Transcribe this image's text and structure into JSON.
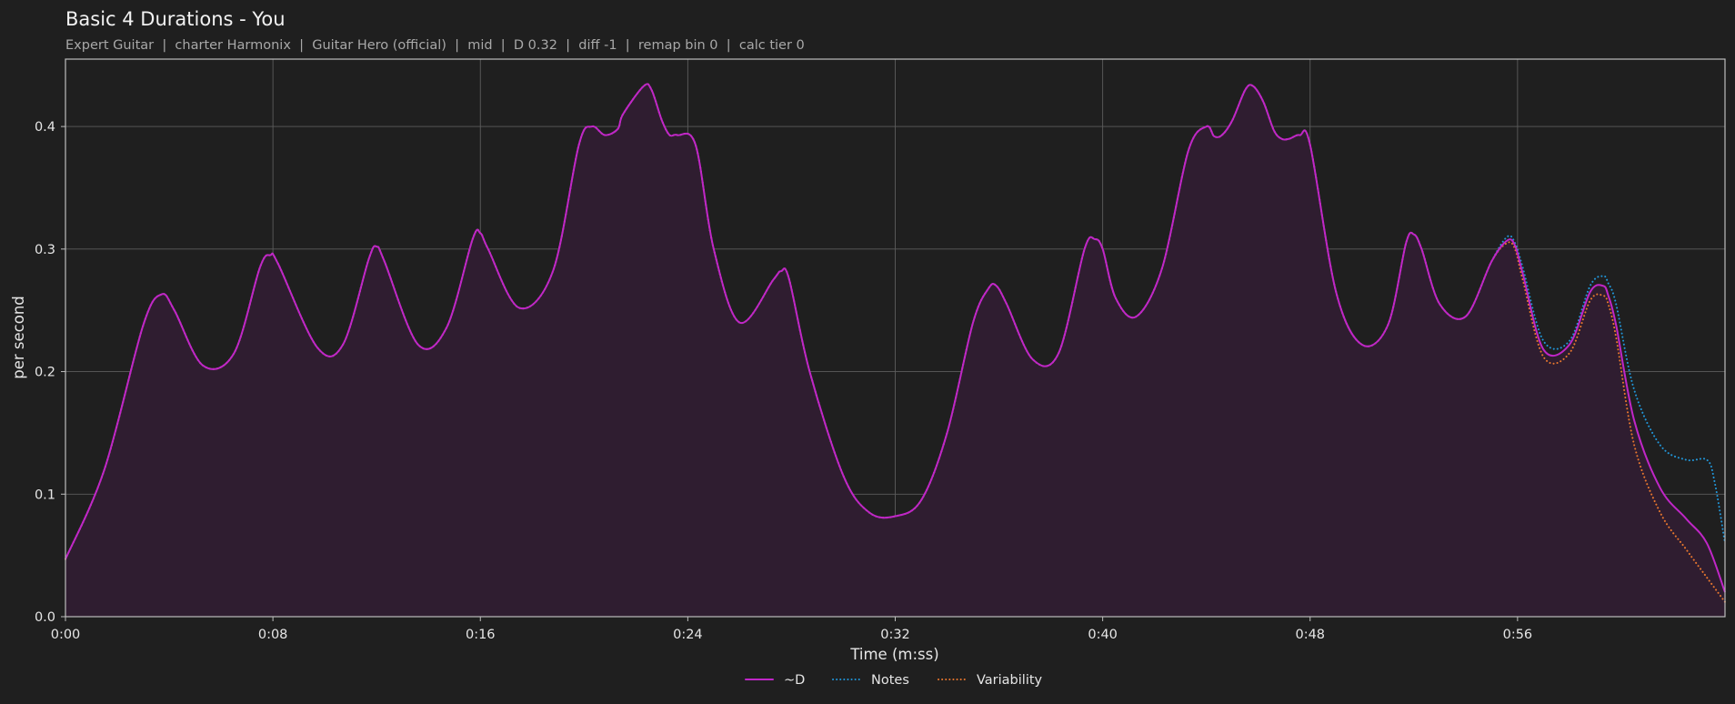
{
  "chart_data": {
    "type": "line",
    "title": "Basic 4 Durations - You",
    "subtitle": "Expert Guitar  |  charter Harmonix  |  Guitar Hero (official)  |  mid  |  D 0.32  |  diff -1  |  remap bin 0  |  calc tier 0",
    "xlabel": "Time (m:ss)",
    "ylabel": "per second",
    "xlim": [
      0,
      64
    ],
    "ylim": [
      0,
      0.455
    ],
    "x_ticks": [
      0,
      8,
      16,
      24,
      32,
      40,
      48,
      56
    ],
    "x_tick_labels": [
      "0:00",
      "0:08",
      "0:16",
      "0:24",
      "0:32",
      "0:40",
      "0:48",
      "0:56"
    ],
    "y_ticks": [
      0,
      0.1,
      0.2,
      0.3,
      0.4
    ],
    "y_tick_labels": [
      "0.0",
      "0.1",
      "0.2",
      "0.3",
      "0.4"
    ],
    "grid": true,
    "legend": "bottom-center",
    "series": [
      {
        "name": "~D",
        "color": "#c026c7",
        "style": "solid",
        "fill": "#2f1d30",
        "x": [
          0,
          1.5,
          3,
          3.7,
          4.2,
          5.3,
          6.5,
          7.5,
          7.9,
          8.2,
          9.7,
          10.7,
          11.7,
          12.0,
          12.3,
          13.6,
          14.7,
          15.7,
          16.0,
          16.3,
          17.5,
          18.8,
          19.8,
          20.3,
          20.8,
          21.3,
          21.5,
          22.3,
          22.6,
          23.0,
          23.3,
          23.6,
          24.3,
          25.0,
          26.0,
          27.3,
          27.6,
          27.9,
          28.7,
          30.0,
          31.0,
          32.0,
          33.0,
          34.0,
          35.0,
          35.6,
          35.9,
          36.3,
          37.3,
          38.3,
          39.3,
          39.7,
          40.0,
          40.5,
          41.3,
          42.3,
          43.3,
          44.0,
          44.3,
          44.6,
          45.0,
          45.5,
          45.8,
          46.2,
          46.6,
          46.9,
          47.2,
          47.6,
          48.0,
          49.0,
          50.0,
          51.0,
          51.7,
          52.0,
          52.3,
          53.0,
          54.0,
          55.0,
          55.6,
          55.9,
          56.2,
          57.0,
          58.0,
          58.8,
          59.3,
          59.5,
          59.8,
          60.5,
          61.5,
          62.5,
          63.3,
          64.0
        ],
        "values": [
          0.047,
          0.12,
          0.238,
          0.263,
          0.25,
          0.205,
          0.215,
          0.285,
          0.295,
          0.288,
          0.22,
          0.222,
          0.292,
          0.302,
          0.29,
          0.222,
          0.236,
          0.308,
          0.313,
          0.3,
          0.252,
          0.282,
          0.385,
          0.4,
          0.393,
          0.398,
          0.41,
          0.433,
          0.43,
          0.405,
          0.393,
          0.393,
          0.385,
          0.3,
          0.24,
          0.275,
          0.282,
          0.276,
          0.2,
          0.115,
          0.085,
          0.082,
          0.095,
          0.15,
          0.24,
          0.268,
          0.27,
          0.255,
          0.21,
          0.215,
          0.3,
          0.308,
          0.3,
          0.26,
          0.245,
          0.285,
          0.38,
          0.4,
          0.392,
          0.393,
          0.405,
          0.43,
          0.433,
          0.42,
          0.397,
          0.39,
          0.39,
          0.393,
          0.385,
          0.265,
          0.222,
          0.238,
          0.305,
          0.312,
          0.3,
          0.255,
          0.245,
          0.29,
          0.307,
          0.303,
          0.28,
          0.218,
          0.222,
          0.265,
          0.27,
          0.262,
          0.238,
          0.16,
          0.105,
          0.08,
          0.06,
          0.02
        ]
      },
      {
        "name": "Notes",
        "color": "#2196d9",
        "style": "dotted",
        "x": [
          0,
          1.5,
          3,
          3.7,
          4.2,
          5.3,
          6.5,
          7.5,
          7.9,
          8.2,
          9.7,
          10.7,
          11.7,
          12.0,
          12.3,
          13.6,
          14.7,
          15.7,
          16.0,
          16.3,
          17.5,
          18.8,
          19.8,
          20.3,
          20.8,
          21.3,
          21.5,
          22.3,
          22.6,
          23.0,
          23.3,
          23.6,
          24.3,
          25.0,
          26.0,
          27.3,
          27.6,
          27.9,
          28.7,
          30.0,
          31.0,
          32.0,
          33.0,
          34.0,
          35.0,
          35.6,
          35.9,
          36.3,
          37.3,
          38.3,
          39.3,
          39.7,
          40.0,
          40.5,
          41.3,
          42.3,
          43.3,
          44.0,
          44.3,
          44.6,
          45.0,
          45.5,
          45.8,
          46.2,
          46.6,
          46.9,
          47.2,
          47.6,
          48.0,
          49.0,
          50.0,
          51.0,
          51.7,
          52.0,
          52.3,
          53.0,
          54.0,
          55.0,
          55.6,
          55.9,
          56.2,
          57.0,
          58.0,
          58.8,
          59.3,
          59.5,
          59.8,
          60.5,
          61.5,
          62.5,
          63.3,
          63.6,
          64.0
        ],
        "values": [
          0.047,
          0.12,
          0.238,
          0.263,
          0.25,
          0.205,
          0.215,
          0.285,
          0.295,
          0.288,
          0.22,
          0.222,
          0.292,
          0.302,
          0.29,
          0.222,
          0.236,
          0.308,
          0.313,
          0.3,
          0.252,
          0.282,
          0.385,
          0.4,
          0.393,
          0.398,
          0.41,
          0.433,
          0.43,
          0.405,
          0.393,
          0.393,
          0.385,
          0.3,
          0.24,
          0.275,
          0.282,
          0.276,
          0.2,
          0.115,
          0.085,
          0.082,
          0.095,
          0.15,
          0.24,
          0.268,
          0.27,
          0.255,
          0.21,
          0.215,
          0.3,
          0.308,
          0.3,
          0.26,
          0.245,
          0.285,
          0.38,
          0.4,
          0.392,
          0.393,
          0.405,
          0.43,
          0.433,
          0.42,
          0.397,
          0.39,
          0.39,
          0.393,
          0.385,
          0.265,
          0.222,
          0.238,
          0.305,
          0.312,
          0.3,
          0.255,
          0.245,
          0.29,
          0.31,
          0.305,
          0.285,
          0.225,
          0.225,
          0.27,
          0.278,
          0.272,
          0.255,
          0.185,
          0.14,
          0.128,
          0.128,
          0.11,
          0.06
        ]
      },
      {
        "name": "Variability",
        "color": "#e8772e",
        "style": "dotted",
        "x": [
          0,
          1.5,
          3,
          3.7,
          4.2,
          5.3,
          6.5,
          7.5,
          7.9,
          8.2,
          9.7,
          10.7,
          11.7,
          12.0,
          12.3,
          13.6,
          14.7,
          15.7,
          16.0,
          16.3,
          17.5,
          18.8,
          19.8,
          20.3,
          20.8,
          21.3,
          21.5,
          22.3,
          22.6,
          23.0,
          23.3,
          23.6,
          24.3,
          25.0,
          26.0,
          27.3,
          27.6,
          27.9,
          28.7,
          30.0,
          31.0,
          32.0,
          33.0,
          34.0,
          35.0,
          35.6,
          35.9,
          36.3,
          37.3,
          38.3,
          39.3,
          39.7,
          40.0,
          40.5,
          41.3,
          42.3,
          43.3,
          44.0,
          44.3,
          44.6,
          45.0,
          45.5,
          45.8,
          46.2,
          46.6,
          46.9,
          47.2,
          47.6,
          48.0,
          49.0,
          50.0,
          51.0,
          51.7,
          52.0,
          52.3,
          53.0,
          54.0,
          55.0,
          55.6,
          55.9,
          56.2,
          57.0,
          58.0,
          58.8,
          59.3,
          59.5,
          59.8,
          60.5,
          61.5,
          62.5,
          63.3,
          64.0
        ],
        "values": [
          0.047,
          0.12,
          0.238,
          0.263,
          0.25,
          0.205,
          0.215,
          0.285,
          0.295,
          0.288,
          0.22,
          0.222,
          0.292,
          0.302,
          0.29,
          0.222,
          0.236,
          0.308,
          0.313,
          0.3,
          0.252,
          0.282,
          0.385,
          0.4,
          0.393,
          0.398,
          0.41,
          0.433,
          0.43,
          0.405,
          0.393,
          0.393,
          0.385,
          0.3,
          0.24,
          0.275,
          0.282,
          0.276,
          0.2,
          0.115,
          0.085,
          0.082,
          0.095,
          0.15,
          0.24,
          0.268,
          0.27,
          0.255,
          0.21,
          0.215,
          0.3,
          0.308,
          0.3,
          0.26,
          0.245,
          0.285,
          0.38,
          0.4,
          0.392,
          0.393,
          0.405,
          0.43,
          0.433,
          0.42,
          0.397,
          0.39,
          0.39,
          0.393,
          0.385,
          0.265,
          0.222,
          0.238,
          0.305,
          0.312,
          0.3,
          0.255,
          0.245,
          0.29,
          0.305,
          0.3,
          0.275,
          0.212,
          0.215,
          0.258,
          0.262,
          0.255,
          0.228,
          0.14,
          0.085,
          0.055,
          0.032,
          0.012
        ]
      }
    ]
  }
}
